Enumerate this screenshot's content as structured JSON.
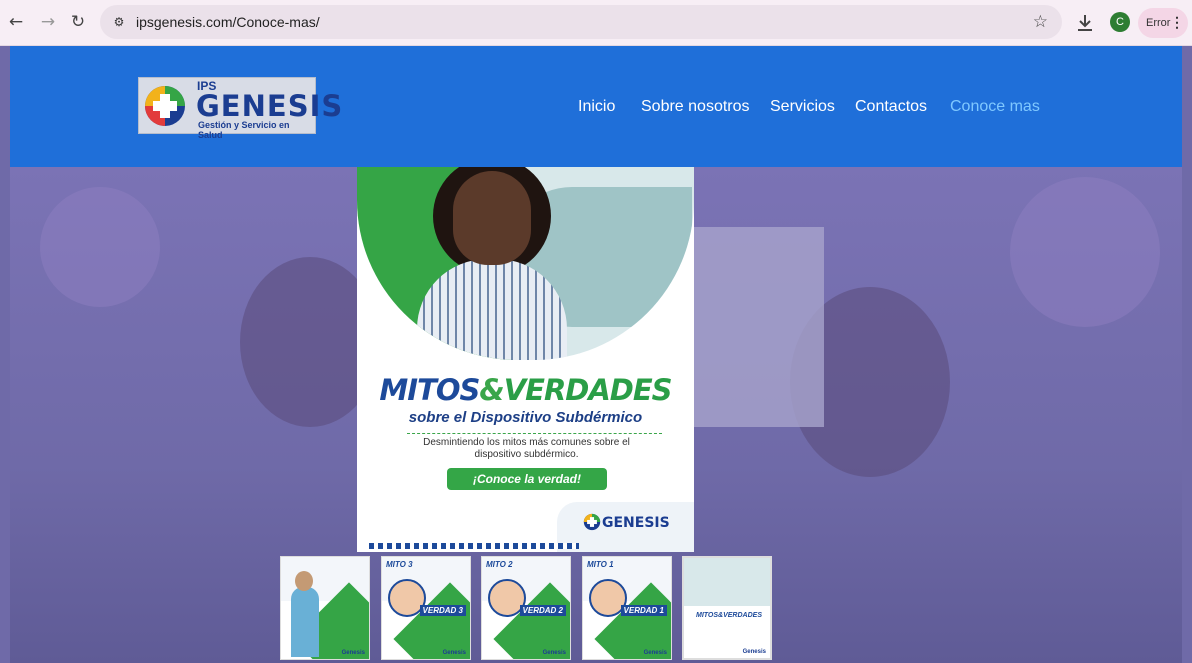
{
  "browser": {
    "url": "ipsgenesis.com/Conoce-mas/",
    "profile_initial": "C",
    "error_label": "Error"
  },
  "header": {
    "logo": {
      "ips": "IPS",
      "name": "GENESIS",
      "tagline": "Gestión y Servicio en Salud"
    },
    "nav": [
      "Inicio",
      "Sobre nosotros",
      "Servicios",
      "Contactos",
      "Conoce mas"
    ]
  },
  "flyer": {
    "title_a": "MITOS",
    "title_amp": "&",
    "title_b": "VERDADES",
    "subtitle": "sobre el Dispositivo Subdérmico",
    "description": "Desmintiendo los mitos más comunes sobre el dispositivo subdérmico.",
    "cta": "¡Conoce la verdad!",
    "logo": "GENESIS"
  },
  "thumbnails": [
    {
      "mito": "",
      "verdad": ""
    },
    {
      "mito": "MITO 3",
      "verdad": "VERDAD 3"
    },
    {
      "mito": "MITO 2",
      "verdad": "VERDAD 2"
    },
    {
      "mito": "MITO 1",
      "verdad": "VERDAD 1"
    },
    {
      "mito": "",
      "verdad": "",
      "title": "MITOS&VERDADES"
    }
  ],
  "colors": {
    "header_blue": "#1f6fd9",
    "active_nav": "#7fc8ff",
    "brand_green": "#35a546",
    "brand_navy": "#1d4a9a"
  }
}
